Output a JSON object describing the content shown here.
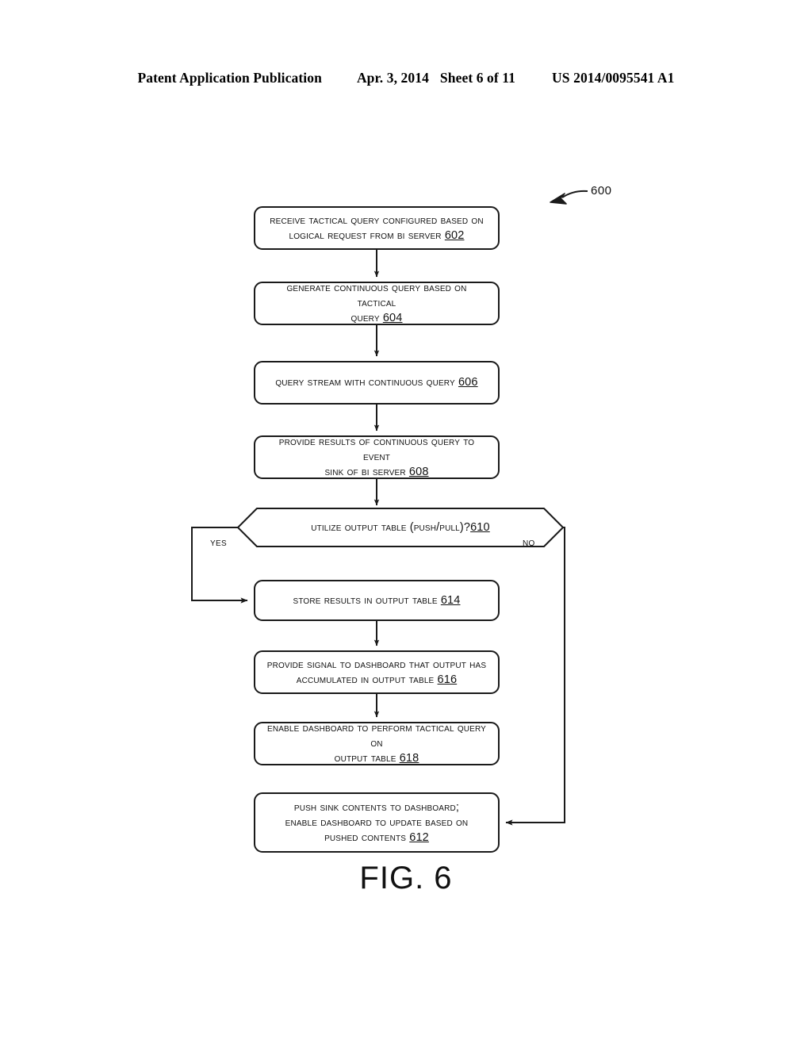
{
  "header": {
    "publication": "Patent Application Publication",
    "date": "Apr. 3, 2014",
    "sheet": "Sheet 6 of 11",
    "patent_number": "US 2014/0095541 A1"
  },
  "figure": {
    "caption": "FIG. 6",
    "reference_numeral": "600",
    "diagram_type": "flowchart",
    "stroke_color": "#1a1a1a",
    "background_color": "#ffffff"
  },
  "nodes": [
    {
      "id": "602",
      "shape": "rounded-rect",
      "text": "Receive Tactical Query Configured based on\nLogical Request from BI Server 602",
      "line1": "Receive Tactical Query Configured based on",
      "line2": "Logical Request from BI Server ",
      "ref": "602"
    },
    {
      "id": "604",
      "shape": "rounded-rect",
      "text": "Generate Continuous Query based on Tactical\nQuery 604",
      "line1": "Generate Continuous Query based on Tactical",
      "line2": "Query ",
      "ref": "604"
    },
    {
      "id": "606",
      "shape": "rounded-rect",
      "text": "Query Stream with Continuous Query 606",
      "line1": "Query Stream with Continuous Query ",
      "line2": "",
      "ref": "606"
    },
    {
      "id": "608",
      "shape": "rounded-rect",
      "text": "Provide Results of Continuous Query to Event\nSink of BI Server 608",
      "line1": "Provide Results of Continuous Query to Event",
      "line2": "Sink of BI Server ",
      "ref": "608"
    },
    {
      "id": "610",
      "shape": "hexagon",
      "text": "Utilize Output Table (Push/Pull)? 610",
      "line1": "Utilize Output Table (Push/Pull)? ",
      "line2": "",
      "ref": "610"
    },
    {
      "id": "614",
      "shape": "rounded-rect",
      "text": "Store Results in Output Table 614",
      "line1": "Store Results in Output Table ",
      "line2": "",
      "ref": "614"
    },
    {
      "id": "616",
      "shape": "rounded-rect",
      "text": "Provide Signal to Dashboard that Output has\nAccumulated in Output Table 616",
      "line1": "Provide Signal to Dashboard that Output has",
      "line2": "Accumulated in Output Table ",
      "ref": "616"
    },
    {
      "id": "618",
      "shape": "rounded-rect",
      "text": "Enable Dashboard to Perform Tactical Query on\noutput Table 618",
      "line1": "Enable Dashboard to Perform Tactical Query on",
      "line2": "output Table ",
      "ref": "618"
    },
    {
      "id": "612",
      "shape": "rounded-rect",
      "text": "Push Sink Contents to Dashboard;\nEnable Dashboard to Update based on\nPushed Contents 612",
      "line1": "Push Sink Contents to Dashboard;",
      "line2": "Enable Dashboard to Update based on",
      "line3": "Pushed Contents ",
      "ref": "612"
    }
  ],
  "branches": {
    "yes_label": "Yes",
    "no_label": "No"
  },
  "edges": [
    {
      "from": "602",
      "to": "604",
      "label": ""
    },
    {
      "from": "604",
      "to": "606",
      "label": ""
    },
    {
      "from": "606",
      "to": "608",
      "label": ""
    },
    {
      "from": "608",
      "to": "610",
      "label": ""
    },
    {
      "from": "610",
      "to": "614",
      "label": "Yes"
    },
    {
      "from": "610",
      "to": "612",
      "label": "No"
    },
    {
      "from": "614",
      "to": "616",
      "label": ""
    },
    {
      "from": "616",
      "to": "618",
      "label": ""
    }
  ]
}
